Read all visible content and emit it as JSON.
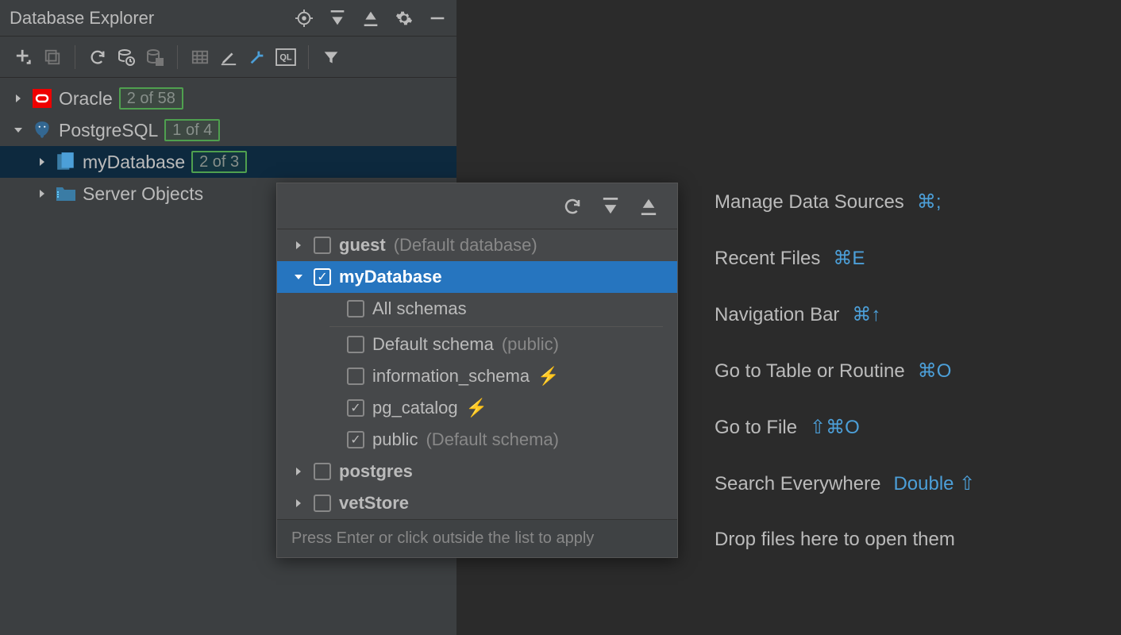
{
  "panel": {
    "title": "Database Explorer"
  },
  "tree": {
    "oracle": {
      "label": "Oracle",
      "badge": "2 of 58"
    },
    "postgres": {
      "label": "PostgreSQL",
      "badge": "1 of 4"
    },
    "mydb": {
      "label": "myDatabase",
      "badge": "2 of 3"
    },
    "server_objects": {
      "label": "Server Objects"
    }
  },
  "popup": {
    "guest": {
      "label": "guest",
      "hint": "(Default database)"
    },
    "mydb": {
      "label": "myDatabase"
    },
    "all_schemas": {
      "label": "All schemas"
    },
    "default_schema": {
      "label": "Default schema",
      "hint": "(public)"
    },
    "information_schema": {
      "label": "information_schema"
    },
    "pg_catalog": {
      "label": "pg_catalog"
    },
    "public": {
      "label": "public",
      "hint": "(Default schema)"
    },
    "postgres": {
      "label": "postgres"
    },
    "vetstore": {
      "label": "vetStore"
    },
    "footer": "Press Enter or click outside the list to apply"
  },
  "welcome": {
    "manage": {
      "label": "Manage Data Sources",
      "shortcut": "⌘;"
    },
    "recent": {
      "label": "Recent Files",
      "shortcut": "⌘E"
    },
    "navbar": {
      "label": "Navigation Bar",
      "shortcut": "⌘↑"
    },
    "goto_table": {
      "label": "Go to Table or Routine",
      "shortcut": "⌘O"
    },
    "goto_file": {
      "label": "Go to File",
      "shortcut": "⇧⌘O"
    },
    "search": {
      "label": "Search Everywhere",
      "shortcut": "Double ⇧"
    },
    "drop": {
      "label": "Drop files here to open them"
    }
  }
}
